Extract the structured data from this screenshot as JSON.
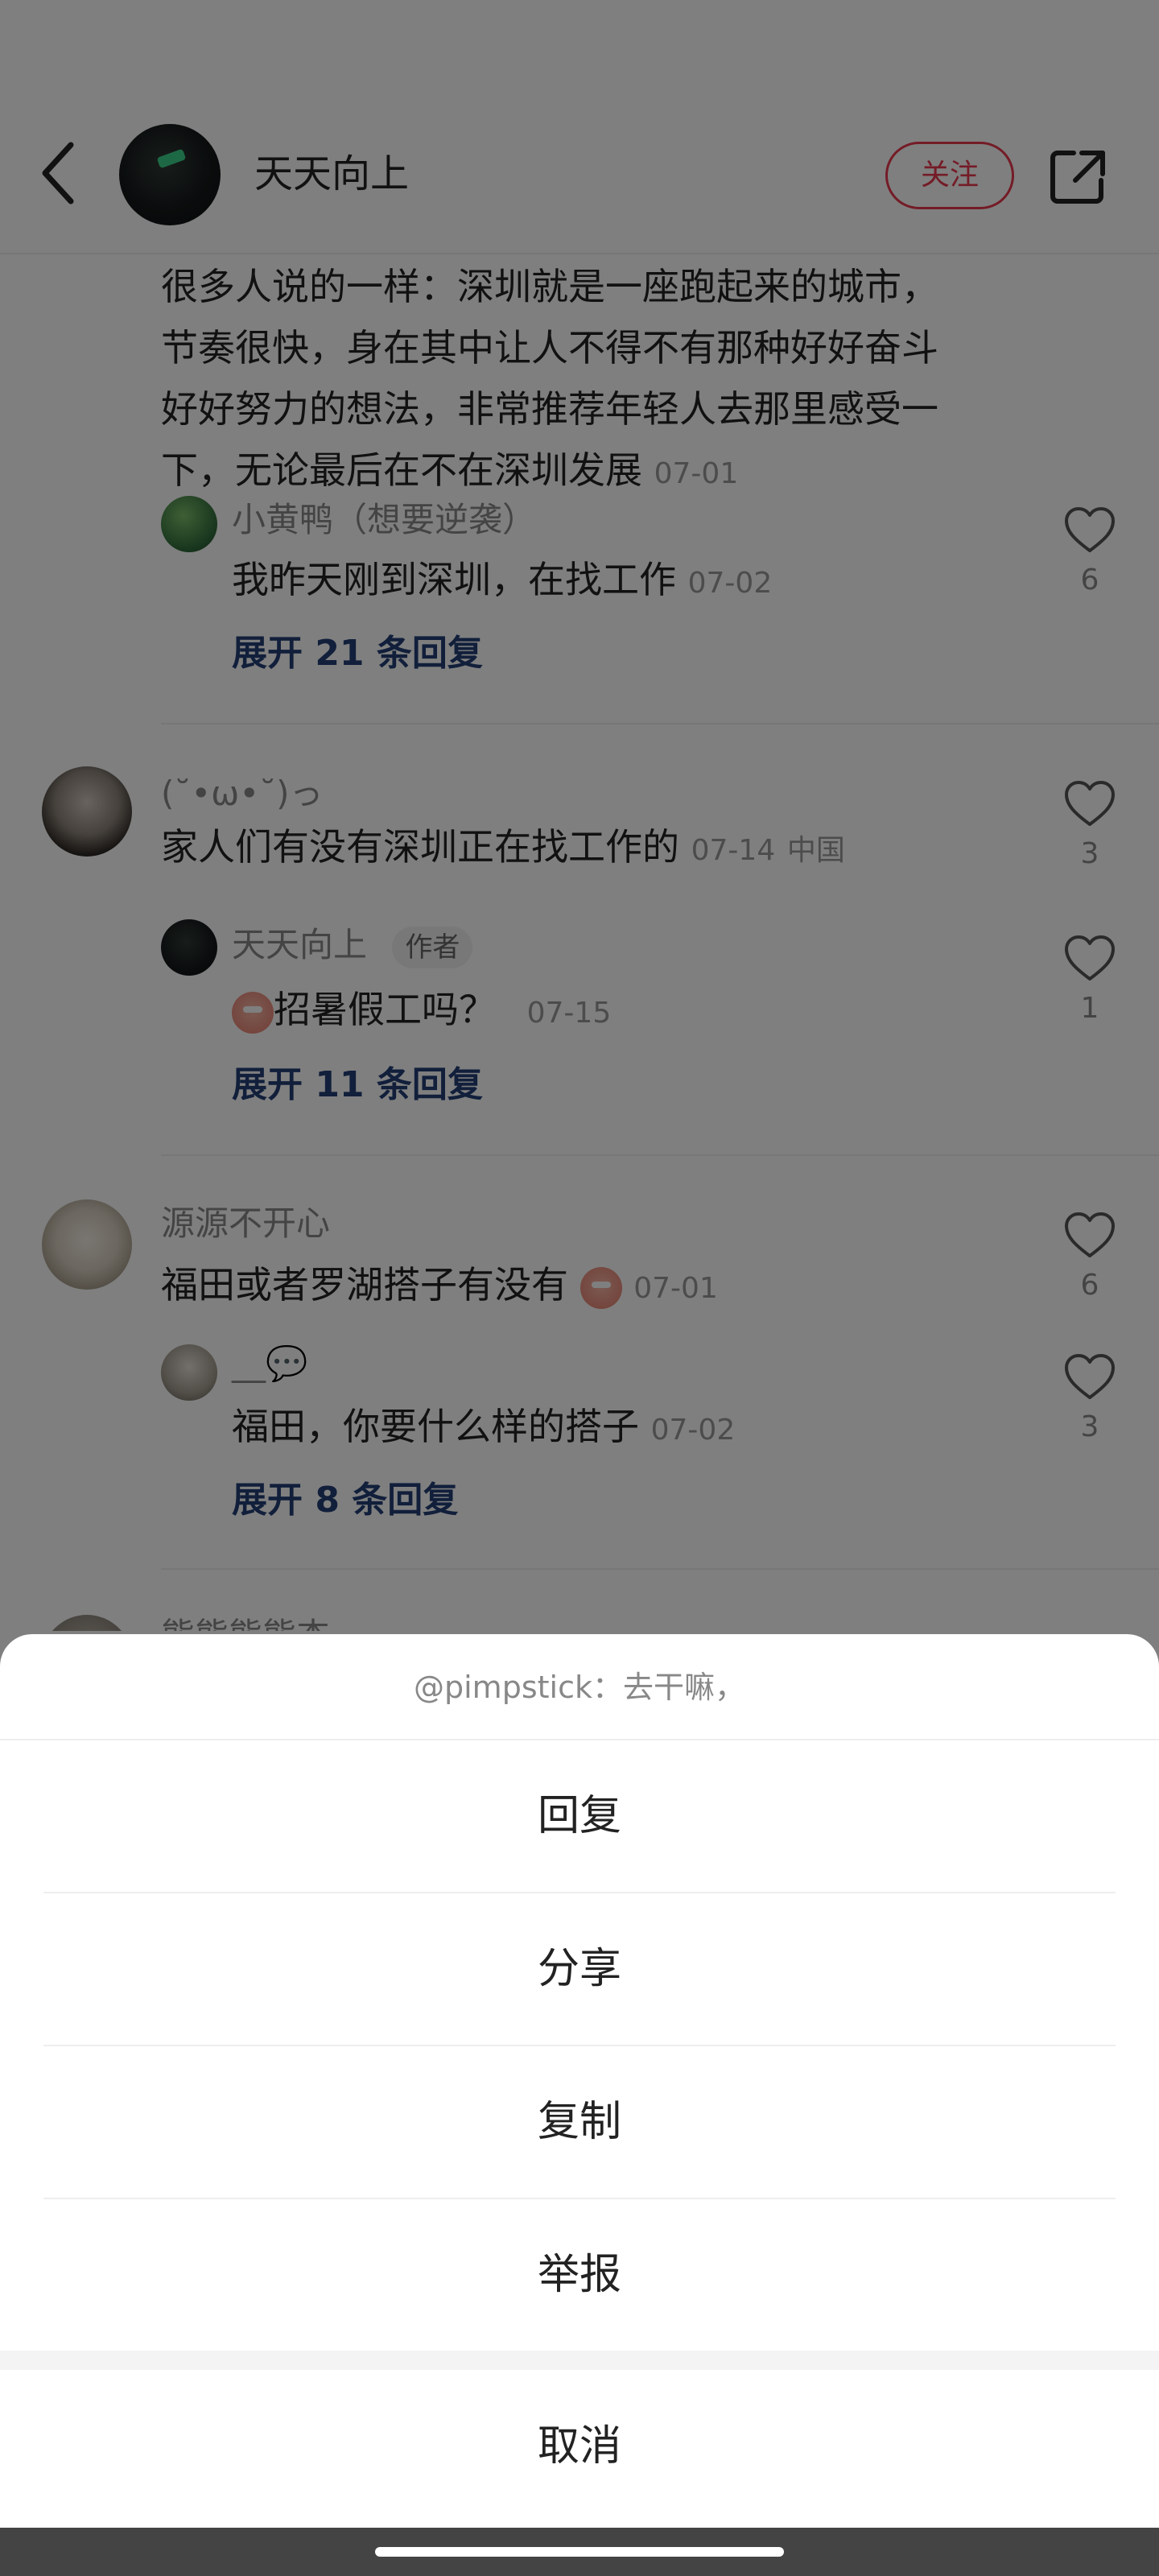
{
  "header": {
    "username": "天天向上",
    "follow_label": "关注"
  },
  "comments": {
    "top_text_lines": [
      "很多人说的一样：深圳就是一座跑起来的城市，",
      "节奏很快，身在其中让人不得不有那种好好奋斗",
      "好好努力的想法，非常推荐年轻人去那里感受一",
      "下，无论最后在不在深圳发展"
    ],
    "top_date": "07-01",
    "reply1": {
      "nick": "小黄鸭（想要逆袭）",
      "text": "我昨天刚到深圳，在找工作",
      "date": "07-02",
      "likes": "6"
    },
    "expand1": "展开 21 条回复",
    "c2": {
      "nick": "(˘•ω•˘)っ",
      "text": "家人们有没有深圳正在找工作的",
      "date": "07-14",
      "location": "中国",
      "likes": "3"
    },
    "reply2": {
      "nick": "天天向上",
      "tag": "作者",
      "text": "招暑假工吗？",
      "date": "07-15",
      "likes": "1"
    },
    "expand2": "展开 11 条回复",
    "c3": {
      "nick": "源源不开心",
      "text": "福田或者罗湖搭子有没有",
      "date": "07-01",
      "likes": "6"
    },
    "reply3": {
      "nick": "__💬",
      "text": "福田，你要什么样的搭子",
      "date": "07-02",
      "likes": "3"
    },
    "expand3": "展开 8 条回复",
    "c4_nick_partial": "熊熊熊熊杰"
  },
  "sheet": {
    "title": "@pimpstick：去干嘛，",
    "items": [
      "回复",
      "分享",
      "复制",
      "举报"
    ],
    "cancel": "取消"
  },
  "colors": {
    "accent_red": "#e8384f",
    "link_blue": "#233f77",
    "overlay": "rgba(0,0,0,0.5)"
  },
  "icons": [
    "back-arrow-icon",
    "share-out-icon",
    "heart-outline-icon"
  ]
}
